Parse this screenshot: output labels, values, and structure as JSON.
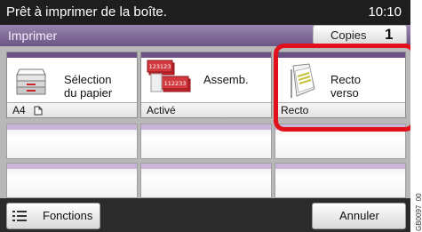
{
  "status": {
    "message": "Prêt à imprimer de la boîte.",
    "time": "10:10"
  },
  "header": {
    "title": "Imprimer",
    "copies_label": "Copies",
    "copies_value": "1"
  },
  "tiles": [
    {
      "label_line1": "Sélection",
      "label_line2": "du papier",
      "value": "A4",
      "icon": "paper-cassette-icon",
      "value_icon": "portrait-page-icon"
    },
    {
      "label_line1": "Assemb.",
      "value": "Activé",
      "icon": "collated-sets-icon",
      "icon_text_top": "123123",
      "icon_text_bottom": "112233"
    },
    {
      "label_line1": "Recto",
      "label_line2": "verso",
      "value": "Recto",
      "icon": "single-sided-page-icon",
      "highlighted": true
    }
  ],
  "footer": {
    "functions_label": "Fonctions",
    "functions_icon": "list-menu-icon",
    "cancel_label": "Annuler"
  },
  "figure_code": "GB0097_00",
  "colors": {
    "highlight": "#e2101a",
    "tile_band": "#6c5385",
    "header": "#7a6494"
  }
}
